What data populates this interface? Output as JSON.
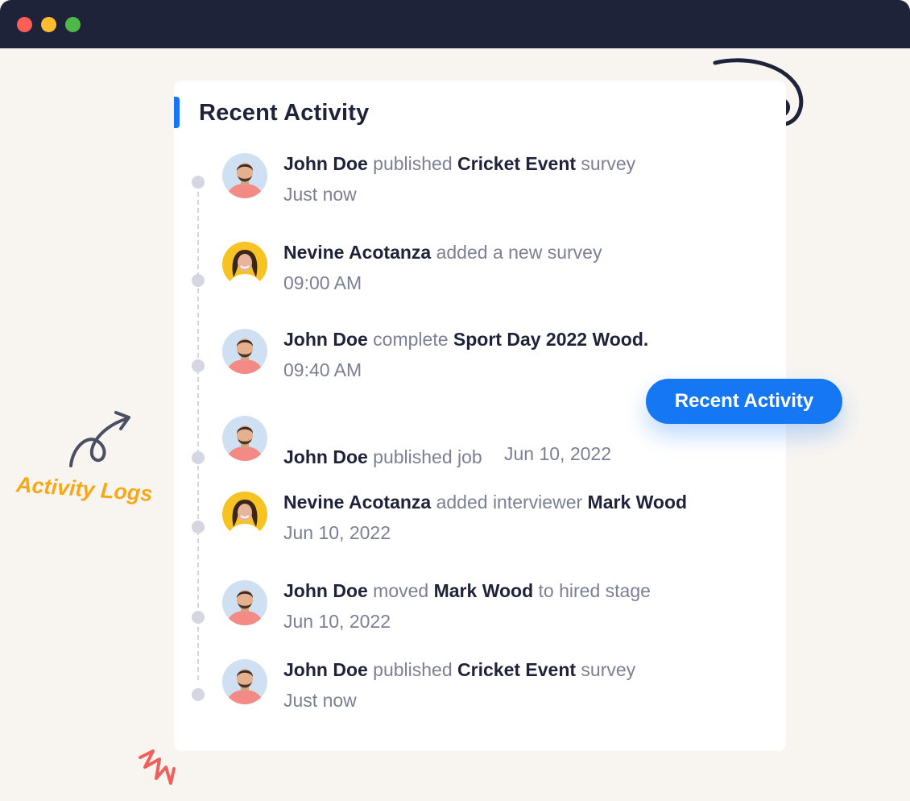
{
  "window": {
    "controls": [
      "close",
      "minimize",
      "maximize"
    ]
  },
  "card": {
    "title": "Recent Activity"
  },
  "activities": [
    {
      "actor": "John Doe",
      "parts": [
        {
          "text": " published ",
          "bold": false
        },
        {
          "text": "Cricket Event",
          "bold": true
        },
        {
          "text": " survey",
          "bold": false
        }
      ],
      "time": "Just now",
      "avatar": "male-avatar"
    },
    {
      "actor": "Nevine Acotanza",
      "parts": [
        {
          "text": " added a new survey",
          "bold": false
        }
      ],
      "time": "09:00 AM",
      "avatar": "female-avatar"
    },
    {
      "actor": "John Doe",
      "parts": [
        {
          "text": " complete ",
          "bold": false
        },
        {
          "text": "Sport Day 2022 Wood.",
          "bold": true
        }
      ],
      "time": "09:40 AM",
      "avatar": "male-avatar"
    },
    {
      "actor": "John Doe",
      "parts": [
        {
          "text": " published job",
          "bold": false
        }
      ],
      "time": "Jun 10, 2022",
      "avatar": "male-avatar",
      "time_inline": true
    },
    {
      "actor": "Nevine Acotanza",
      "parts": [
        {
          "text": " added interviewer ",
          "bold": false
        },
        {
          "text": "Mark Wood",
          "bold": true
        }
      ],
      "time": "Jun 10, 2022",
      "avatar": "female-avatar"
    },
    {
      "actor": "John Doe",
      "parts": [
        {
          "text": " moved ",
          "bold": false
        },
        {
          "text": "Mark Wood",
          "bold": true
        },
        {
          "text": " to hired stage",
          "bold": false
        }
      ],
      "time": "Jun 10, 2022",
      "avatar": "male-avatar"
    },
    {
      "actor": "John Doe",
      "parts": [
        {
          "text": " published ",
          "bold": false
        },
        {
          "text": "Cricket Event",
          "bold": true
        },
        {
          "text": " survey",
          "bold": false
        }
      ],
      "time": "Just now",
      "avatar": "male-avatar"
    }
  ],
  "badge": {
    "label": "Recent Activity"
  },
  "side_label": "Activity Logs",
  "colors": {
    "accent": "#1677f5",
    "titlebar": "#1e2339",
    "highlight": "#f8a817",
    "scribble": "#f0605a"
  },
  "icons": [
    "curved-arrow-icon",
    "swirl-scribble-icon",
    "zigzag-scribble-icon"
  ]
}
